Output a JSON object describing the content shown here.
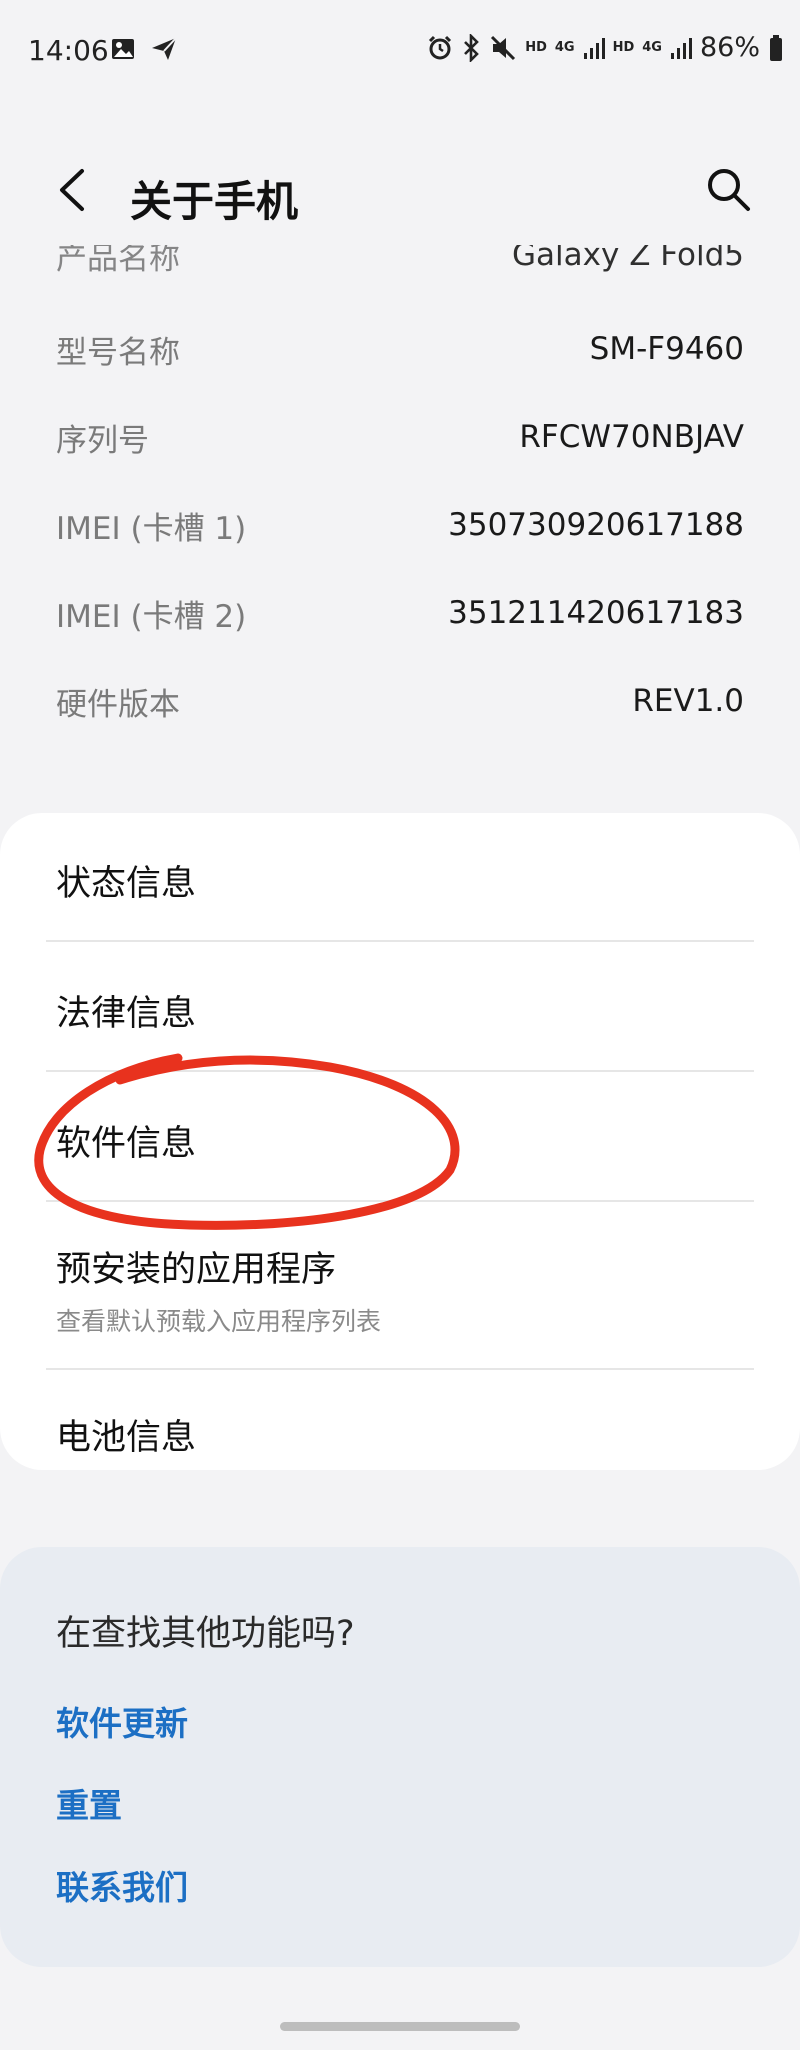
{
  "status_bar": {
    "time": "14:06",
    "battery_percent": "86%",
    "network_1": "4G",
    "network_2": "4G",
    "hd_1": "HD",
    "hd_2": "HD"
  },
  "app_bar": {
    "title": "关于手机"
  },
  "info_rows": [
    {
      "label": "产品名称",
      "value": "Galaxy Z Fold5"
    },
    {
      "label": "型号名称",
      "value": "SM-F9460"
    },
    {
      "label": "序列号",
      "value": "RFCW70NBJAV"
    },
    {
      "label": "IMEI (卡槽 1)",
      "value": "350730920617188"
    },
    {
      "label": "IMEI (卡槽 2)",
      "value": "351211420617183"
    },
    {
      "label": "硬件版本",
      "value": "REV1.0"
    }
  ],
  "menu": {
    "status_info": "状态信息",
    "legal_info": "法律信息",
    "software_info": "软件信息",
    "preinstalled_apps": "预安装的应用程序",
    "preinstalled_apps_sub": "查看默认预载入应用程序列表",
    "battery_info": "电池信息"
  },
  "suggestions": {
    "question": "在查找其他功能吗?",
    "links": [
      "软件更新",
      "重置",
      "联系我们"
    ]
  },
  "colors": {
    "annotation": "#e8321e",
    "link": "#1c6fc4",
    "background": "#f3f3f5"
  }
}
